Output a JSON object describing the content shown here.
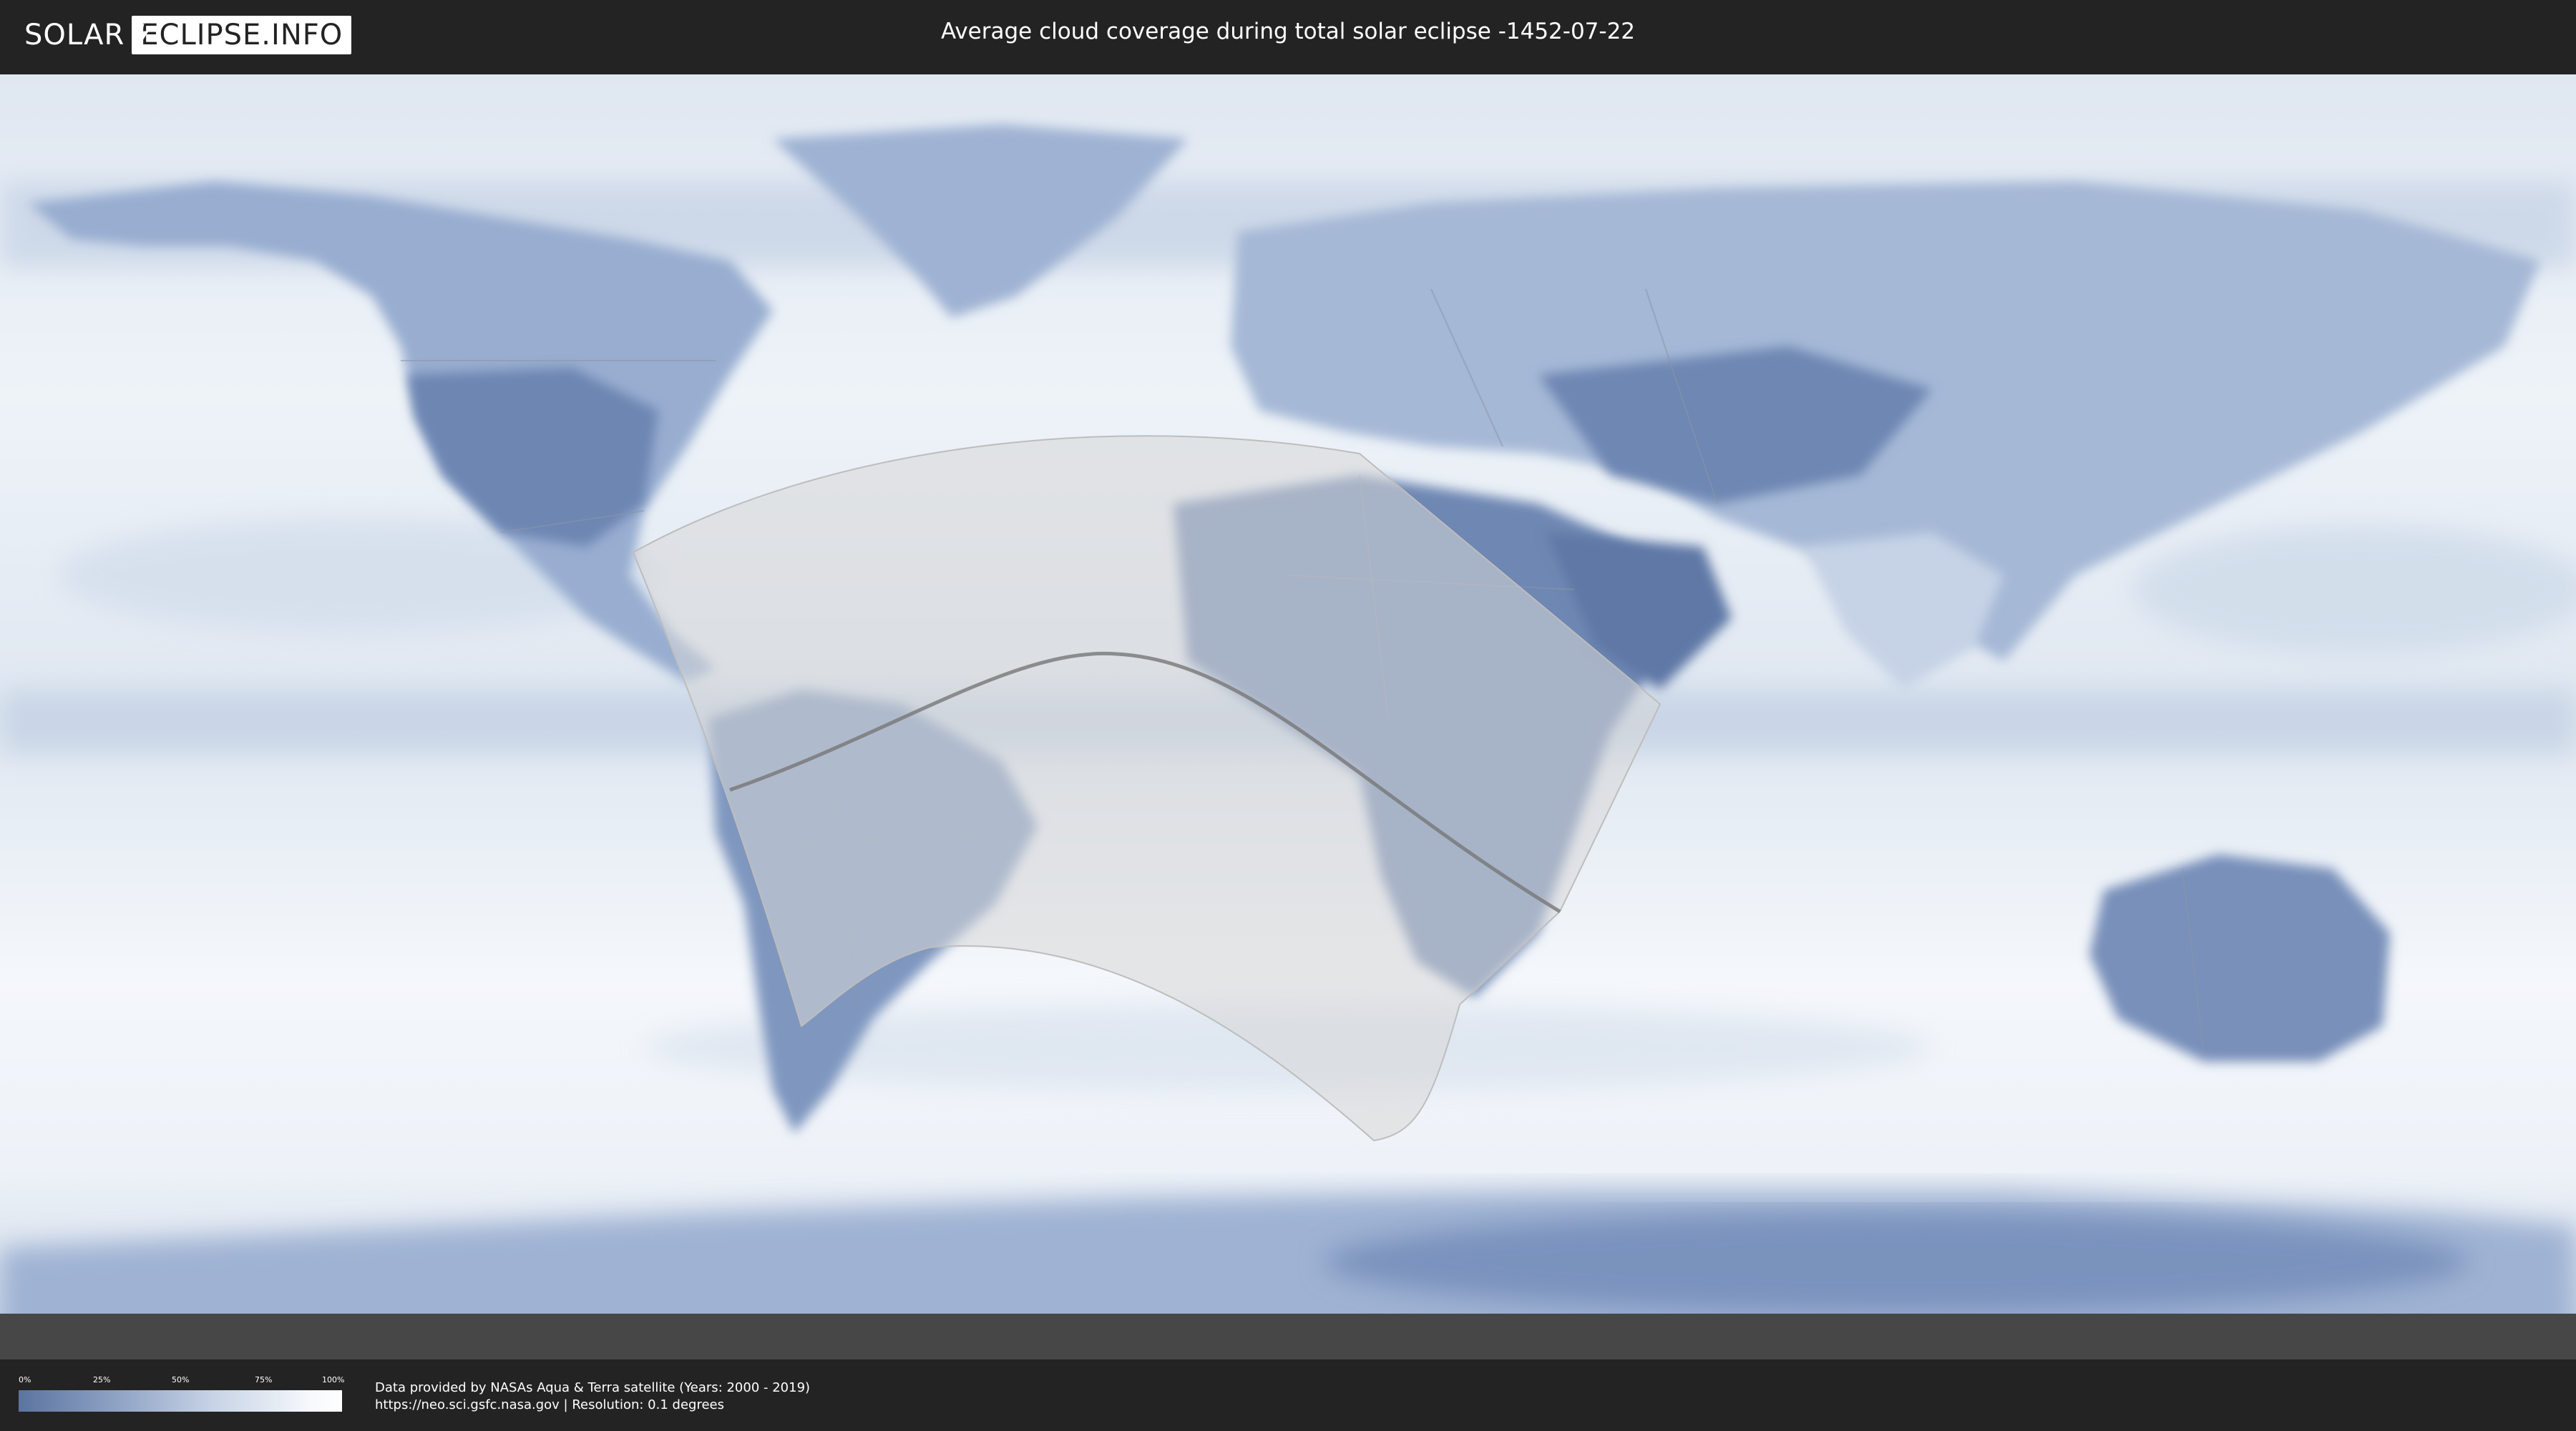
{
  "header": {
    "logo_left": "SOLAR",
    "logo_right": "ECLIPSE.INFO",
    "title": "Average cloud coverage during total solar eclipse -1452-07-22"
  },
  "map": {
    "colors": {
      "ocean_clear": "#f4f7fb",
      "cloud_sparse": "#5a73a0",
      "cloud_mid": "#a9bbd6",
      "eclipse_zone": "#d7d7d7",
      "path_line": "#777777",
      "country_border": "#8c96a6"
    },
    "layers": [
      "cloud-coverage",
      "country-borders",
      "eclipse-visibility-zone",
      "totality-path"
    ]
  },
  "legend": {
    "ticks": [
      "0%",
      "25%",
      "50%",
      "75%",
      "100%"
    ],
    "gradient_from": "#5b74a0",
    "gradient_to": "#ffffff"
  },
  "footer": {
    "credit_line1": "Data provided by NASAs Aqua & Terra satellite (Years: 2000 - 2019)",
    "credit_line2": "https://neo.sci.gsfc.nasa.gov | Resolution: 0.1 degrees"
  }
}
